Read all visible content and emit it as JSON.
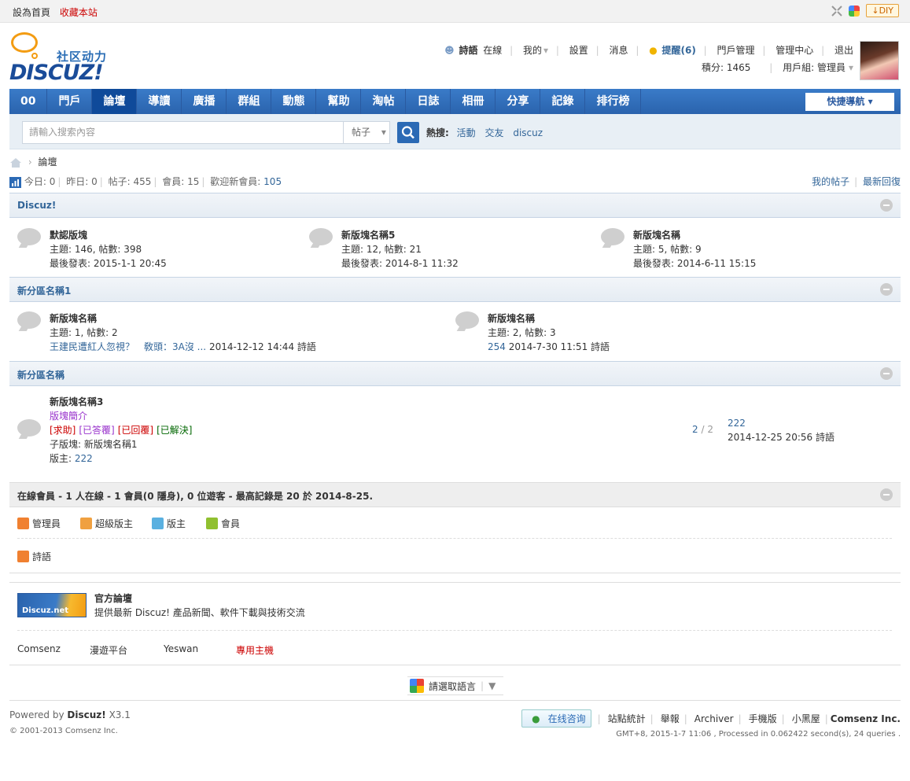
{
  "topbar": {
    "set_home": "設為首頁",
    "favorite": "收藏本站",
    "diy": "DIY",
    "diy_icon": "arrow-down-icon"
  },
  "logo": {
    "slogan": "社区动力",
    "word": "DISCUZ!"
  },
  "user": {
    "name": "詩語",
    "status": "在線",
    "menu_mine": "我的",
    "settings": "設置",
    "messages": "消息",
    "remind": "提醒(6)",
    "portal_manage": "門戶管理",
    "admin_center": "管理中心",
    "logout": "退出",
    "credits": "積分: 1465",
    "usergroup": "用戶組: 管理員"
  },
  "nav": {
    "items": [
      "00",
      "門戶",
      "論壇",
      "導讀",
      "廣播",
      "群組",
      "動態",
      "幫助",
      "淘帖",
      "日誌",
      "相冊",
      "分享",
      "記錄",
      "排行榜"
    ],
    "active": "論壇",
    "quick": "快捷導航"
  },
  "search": {
    "placeholder": "請輸入搜索內容",
    "type": "帖子",
    "hot_label": "熱搜:",
    "hot": [
      "活動",
      "交友",
      "discuz"
    ]
  },
  "breadcrumb": {
    "current": "論壇"
  },
  "stats": {
    "today_label": "今日:",
    "today": "0",
    "yesterday_label": "昨日:",
    "yesterday": "0",
    "posts_label": "帖子:",
    "posts": "455",
    "members_label": "會員:",
    "members": "15",
    "welcome_label": "歡迎新會員:",
    "welcome": "105",
    "my_posts": "我的帖子",
    "latest_reply": "最新回復"
  },
  "sections": [
    {
      "title": "Discuz!",
      "forums": [
        {
          "name": "默認版塊",
          "counts": "主題: 146, 帖數: 398",
          "last": "最後發表: 2015-1-1 20:45"
        },
        {
          "name": "新版塊名稱5",
          "counts": "主題: 12, 帖數: 21",
          "last": "最後發表: 2014-8-1 11:32"
        },
        {
          "name": "新版塊名稱",
          "counts": "主題: 5, 帖數: 9",
          "last": "最後發表: 2014-6-11 15:15"
        }
      ]
    },
    {
      "title": "新分區名稱1",
      "forums": [
        {
          "name": "新版塊名稱",
          "counts": "主題: 1, 帖數: 2",
          "last_link": "王建民遭紅人忽視？　敎頭：3A沒 ...",
          "last_rest": "2014-12-12 14:44 詩語"
        },
        {
          "name": "新版塊名稱",
          "counts": "主題: 2, 帖數: 3",
          "last_link": "254",
          "last_rest": "2014-7-30 11:51 詩語"
        }
      ]
    },
    {
      "title": "新分區名稱",
      "forum": {
        "name": "新版塊名稱3",
        "desc": "版塊簡介",
        "tags": [
          "[求助]",
          "[已答覆]",
          "[已回覆]",
          "[已解決]"
        ],
        "tag_colors": [
          "#cc0000",
          "#9933cc",
          "#cc0000",
          "#006600"
        ],
        "sub": "子版塊: 新版塊名稱1",
        "moderator_label": "版主:",
        "moderator": "222",
        "threads": "2",
        "posts": "2",
        "last_title": "222",
        "last_info": "2014-12-25 20:56 詩語"
      }
    }
  ],
  "online": {
    "title": "在線會員 - 1 人在線 - 1 會員(0 隱身), 0 位遊客 - 最高記錄是 20 於 2014-8-25.",
    "legend": [
      {
        "label": "管理員",
        "color": "#f08030"
      },
      {
        "label": "超級版主",
        "color": "#f0a040"
      },
      {
        "label": "版主",
        "color": "#5ab0e0"
      },
      {
        "label": "會員",
        "color": "#90c030"
      }
    ],
    "users": [
      {
        "label": "詩語",
        "color": "#f08030"
      }
    ]
  },
  "links": {
    "official_title": "官方論壇",
    "official_desc": "提供最新 Discuz! 產品新聞、軟件下載與技術交流",
    "official_logo": "Discuz.net",
    "partners": [
      "Comsenz",
      "漫遊平台",
      "Yeswan",
      "專用主機"
    ]
  },
  "language": {
    "label": "請選取語言"
  },
  "footer": {
    "powered": "Powered by",
    "product": "Discuz!",
    "version": "X3.1",
    "copyright": "© 2001-2013 Comsenz Inc.",
    "consult": "在线咨询",
    "links": [
      "站點統計",
      "舉報",
      "Archiver",
      "手機版",
      "小黑屋",
      "Comsenz Inc."
    ],
    "info": "GMT+8, 2015-1-7 11:06 , Processed in 0.062422 second(s), 24 queries ."
  }
}
